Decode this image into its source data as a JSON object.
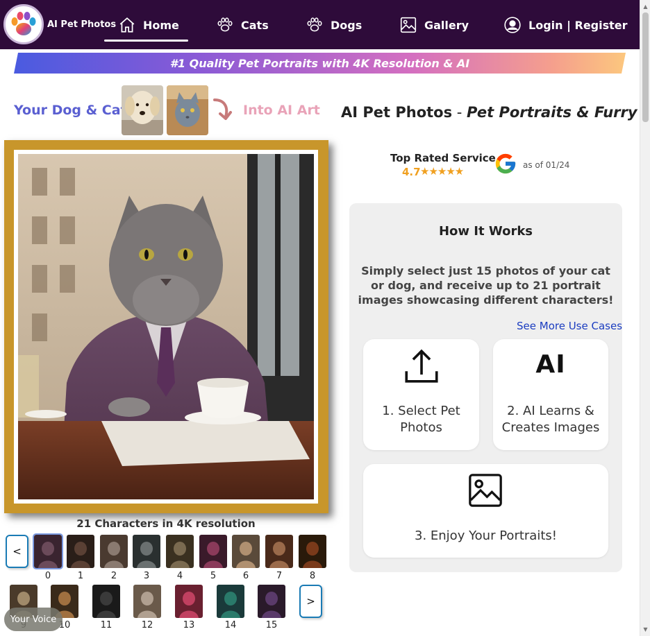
{
  "header": {
    "brand": "AI Pet Photos",
    "nav": [
      {
        "label": "Home",
        "icon": "home-icon"
      },
      {
        "label": "Cats",
        "icon": "paw-icon"
      },
      {
        "label": "Dogs",
        "icon": "paw-icon"
      },
      {
        "label": "Gallery",
        "icon": "image-icon"
      },
      {
        "label": "Login | Register",
        "icon": "user-circle-icon"
      }
    ],
    "active": "Home",
    "background": "#2e0b3a"
  },
  "banner": {
    "text": "#1 Quality Pet Portraits with 4K Resolution & AI"
  },
  "hero": {
    "left_text": "Your Dog & Cat",
    "right_text": "Into AI Art"
  },
  "gallery": {
    "caption": "21 Characters in 4K resolution",
    "prev_label": "<",
    "next_label": ">",
    "thumbnails": [
      "0",
      "1",
      "2",
      "3",
      "4",
      "5",
      "6",
      "7",
      "8",
      "9",
      "10",
      "11",
      "12",
      "13",
      "14",
      "15"
    ],
    "selected": "0"
  },
  "right": {
    "title_main": "AI Pet Photos",
    "title_sep": " - ",
    "title_sub": "Pet Portraits & Furry Art",
    "rating_label": "Top Rated Service",
    "rating_score": "4.7",
    "rating_stars": "★★★★★",
    "rating_date": "as of 01/24"
  },
  "how": {
    "title": "How It Works",
    "description": "Simply select just 15 photos of your cat or dog, and receive up to 21 portrait images showcasing different characters!",
    "see_more": "See More Use Cases",
    "steps": [
      {
        "line1": "1. Select Pet",
        "line2": "Photos",
        "icon": "upload-icon"
      },
      {
        "line1": "2. AI Learns &",
        "line2": "Creates Images",
        "icon": "ai-icon"
      },
      {
        "line1": "3. Enjoy Your Portraits!",
        "line2": "",
        "icon": "image-icon"
      }
    ],
    "ai_glyph": "AI"
  },
  "feedback": {
    "label": "Your Voice"
  }
}
